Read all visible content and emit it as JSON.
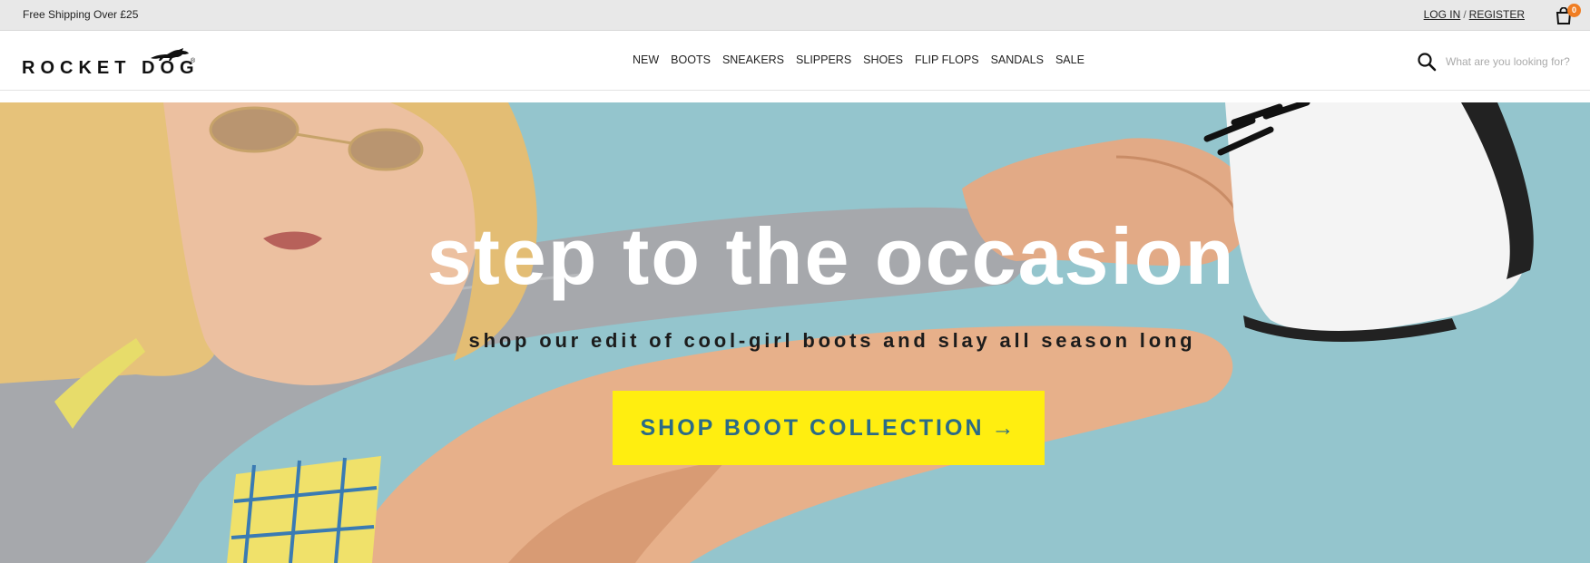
{
  "topbar": {
    "promo": "Free Shipping Over £25",
    "login": "LOG IN",
    "separator": "/",
    "register": "REGISTER",
    "cart_count": "0"
  },
  "header": {
    "logo_text": "ROCKET DOG",
    "nav": [
      "NEW",
      "BOOTS",
      "SNEAKERS",
      "SLIPPERS",
      "SHOES",
      "FLIP FLOPS",
      "SANDALS",
      "SALE"
    ]
  },
  "search": {
    "placeholder": "What are you looking for?",
    "icon": "search-icon"
  },
  "hero": {
    "title": "step to the occasion",
    "subtitle": "shop our edit of cool-girl boots and slay all season long",
    "cta": "SHOP BOOT COLLECTION",
    "cta_arrow": "→"
  },
  "colors": {
    "hero_background": "#94c5cd",
    "cta_background": "#ffee10",
    "cta_text": "#2b6b87",
    "cart_badge": "#f07d22",
    "topbar_background": "#e8e8e8"
  }
}
